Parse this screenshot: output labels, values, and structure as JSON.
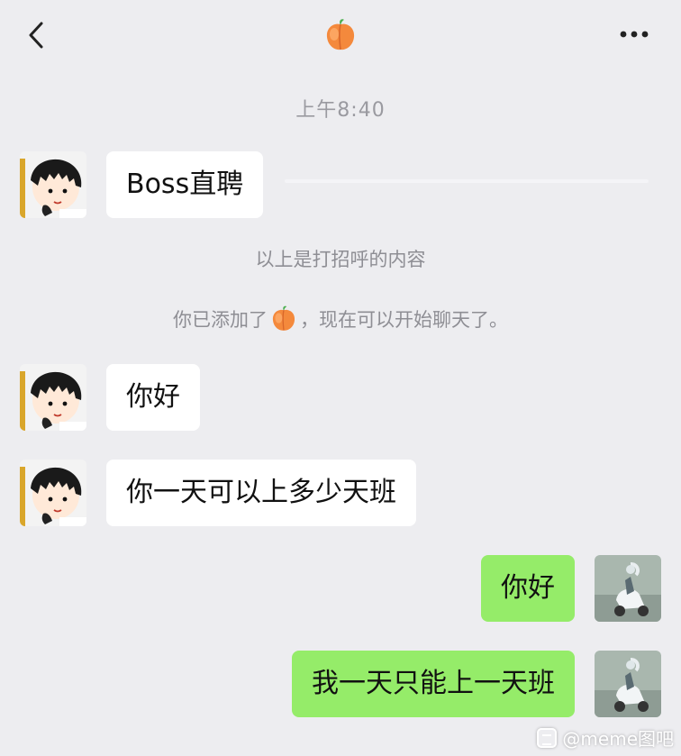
{
  "header": {
    "contact_icon": "peach-emoji",
    "back_icon": "chevron-left-icon",
    "more_icon": "more-dots-icon"
  },
  "chat": {
    "timestamp": "上午8:40",
    "messages": [
      {
        "from": "them",
        "text": "Boss直聘"
      },
      {
        "from": "system",
        "text": "以上是打招呼的内容"
      },
      {
        "from": "system",
        "prefix": "你已添加了",
        "suffix": "，现在可以开始聊天了。"
      },
      {
        "from": "them",
        "text": "你好"
      },
      {
        "from": "them",
        "text": "你一天可以上多少天班"
      },
      {
        "from": "me",
        "text": "你好"
      },
      {
        "from": "me",
        "text": "我一天只能上一天班"
      }
    ]
  },
  "watermark": {
    "text": "@meme图吧"
  },
  "colors": {
    "background": "#ededf0",
    "incoming_bubble": "#ffffff",
    "outgoing_bubble": "#95ec69",
    "system_text": "#8e8e94"
  }
}
